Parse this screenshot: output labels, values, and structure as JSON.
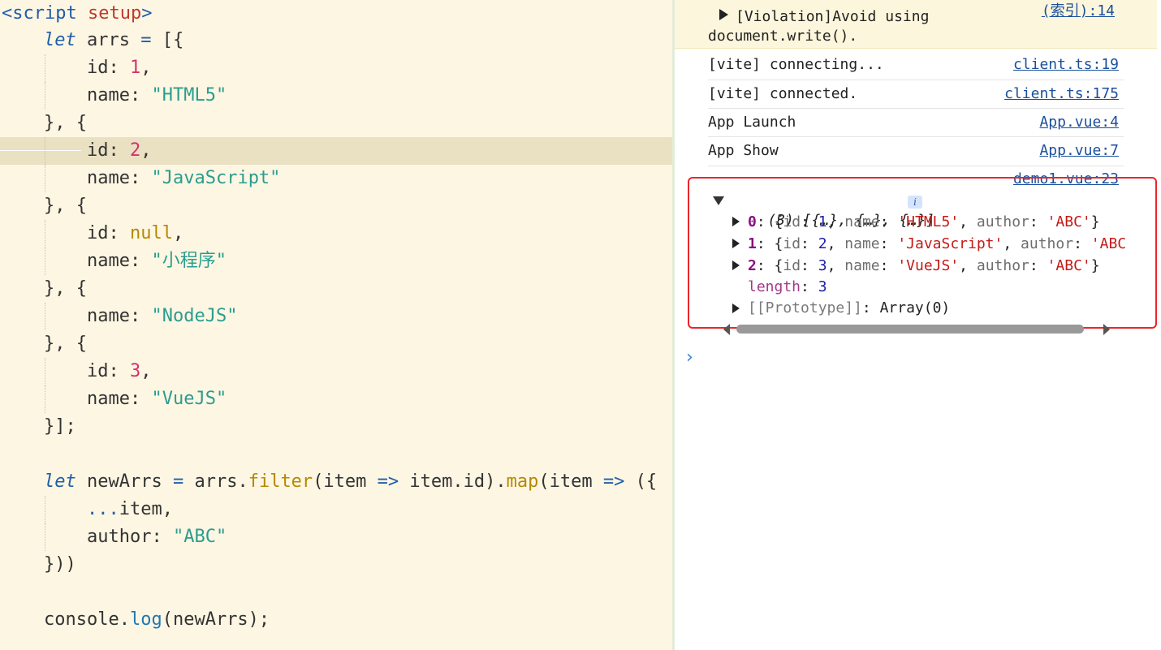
{
  "editor": {
    "lines": [
      {
        "tokens": [
          {
            "t": "<script",
            "c": "tag"
          },
          {
            "t": " ",
            "c": "plain"
          },
          {
            "t": "setup",
            "c": "attr"
          },
          {
            "t": ">",
            "c": "tag"
          }
        ]
      },
      {
        "tokens": [
          {
            "t": "let",
            "c": "kw"
          },
          {
            "t": " arrs ",
            "c": "plain"
          },
          {
            "t": "=",
            "c": "arrow"
          },
          {
            "t": " [{",
            "c": "plain"
          }
        ]
      },
      {
        "tokens": [
          {
            "t": "id: ",
            "c": "plain"
          },
          {
            "t": "1",
            "c": "num"
          },
          {
            "t": ",",
            "c": "plain"
          }
        ]
      },
      {
        "tokens": [
          {
            "t": "name: ",
            "c": "plain"
          },
          {
            "t": "\"HTML5\"",
            "c": "str"
          }
        ]
      },
      {
        "tokens": [
          {
            "t": "}, {",
            "c": "plain"
          }
        ]
      },
      {
        "tokens": [
          {
            "t": "id: ",
            "c": "plain"
          },
          {
            "t": "2",
            "c": "num"
          },
          {
            "t": ",",
            "c": "plain"
          }
        ]
      },
      {
        "tokens": [
          {
            "t": "name: ",
            "c": "plain"
          },
          {
            "t": "\"JavaScript\"",
            "c": "str"
          }
        ]
      },
      {
        "tokens": [
          {
            "t": "}, {",
            "c": "plain"
          }
        ]
      },
      {
        "tokens": [
          {
            "t": "id: ",
            "c": "plain"
          },
          {
            "t": "null",
            "c": "nul"
          },
          {
            "t": ",",
            "c": "plain"
          }
        ]
      },
      {
        "tokens": [
          {
            "t": "name: ",
            "c": "plain"
          },
          {
            "t": "\"小程序\"",
            "c": "str"
          }
        ]
      },
      {
        "tokens": [
          {
            "t": "}, {",
            "c": "plain"
          }
        ]
      },
      {
        "tokens": [
          {
            "t": "name: ",
            "c": "plain"
          },
          {
            "t": "\"NodeJS\"",
            "c": "str"
          }
        ]
      },
      {
        "tokens": [
          {
            "t": "}, {",
            "c": "plain"
          }
        ]
      },
      {
        "tokens": [
          {
            "t": "id: ",
            "c": "plain"
          },
          {
            "t": "3",
            "c": "num"
          },
          {
            "t": ",",
            "c": "plain"
          }
        ]
      },
      {
        "tokens": [
          {
            "t": "name: ",
            "c": "plain"
          },
          {
            "t": "\"VueJS\"",
            "c": "str"
          }
        ]
      },
      {
        "tokens": [
          {
            "t": "}];",
            "c": "plain"
          }
        ]
      },
      {
        "tokens": []
      },
      {
        "tokens": [
          {
            "t": "let",
            "c": "kw"
          },
          {
            "t": " newArrs ",
            "c": "plain"
          },
          {
            "t": "=",
            "c": "arrow"
          },
          {
            "t": " arrs.",
            "c": "plain"
          },
          {
            "t": "filter",
            "c": "fn"
          },
          {
            "t": "(item ",
            "c": "plain"
          },
          {
            "t": "=>",
            "c": "arrow"
          },
          {
            "t": " item.id).",
            "c": "plain"
          },
          {
            "t": "map",
            "c": "fn"
          },
          {
            "t": "(item ",
            "c": "plain"
          },
          {
            "t": "=>",
            "c": "arrow"
          },
          {
            "t": " ({",
            "c": "plain"
          }
        ]
      },
      {
        "tokens": [
          {
            "t": "...",
            "c": "arrow"
          },
          {
            "t": "item,",
            "c": "plain"
          }
        ]
      },
      {
        "tokens": [
          {
            "t": "author: ",
            "c": "plain"
          },
          {
            "t": "\"ABC\"",
            "c": "str"
          }
        ]
      },
      {
        "tokens": [
          {
            "t": "}))",
            "c": "plain"
          }
        ]
      },
      {
        "tokens": []
      },
      {
        "tokens": [
          {
            "t": "console.",
            "c": "plain"
          },
          {
            "t": "log",
            "c": "method"
          },
          {
            "t": "(newArrs);",
            "c": "plain"
          }
        ]
      }
    ]
  },
  "console": {
    "violation": {
      "line1": "[Violation]Avoid using",
      "line2": "document.write().",
      "source": "(索引):14"
    },
    "messages": [
      {
        "text": "[vite] connecting...",
        "source": "client.ts:19"
      },
      {
        "text": "[vite] connected.",
        "source": "client.ts:175"
      },
      {
        "text": "App Launch",
        "source": "App.vue:4"
      },
      {
        "text": "App Show",
        "source": "App.vue:7"
      }
    ],
    "log": {
      "source": "demo1.vue:23",
      "summary": "(3) [{…}, {…}, {…}]",
      "info_icon": "i",
      "items": [
        {
          "index": "0",
          "id": "1",
          "name": "'HTML5'",
          "author": "'ABC'",
          "close": "}"
        },
        {
          "index": "1",
          "id": "2",
          "name": "'JavaScript'",
          "author": "'ABC",
          "close": ""
        },
        {
          "index": "2",
          "id": "3",
          "name": "'VueJS'",
          "author": "'ABC'",
          "close": "}"
        }
      ],
      "length_key": "length",
      "length_value": "3",
      "prototype_key": "[[Prototype]]",
      "prototype_value": "Array(0)"
    },
    "prompt_glyph": "›"
  }
}
